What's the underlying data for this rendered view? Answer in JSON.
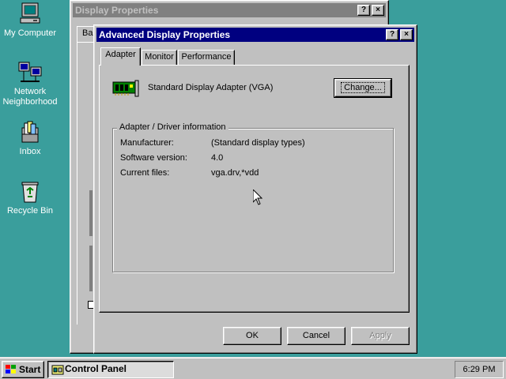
{
  "desktop": {
    "icons": [
      {
        "label": "My Computer"
      },
      {
        "label": "Network Neighborhood"
      },
      {
        "label": "Inbox"
      },
      {
        "label": "Recycle Bin"
      }
    ]
  },
  "back_window": {
    "title": "Display Properties",
    "tab_fragment": "Ba",
    "help_btn": "?",
    "close_btn": "×"
  },
  "dialog": {
    "title": "Advanced Display Properties",
    "help_btn": "?",
    "close_btn": "×",
    "tabs": [
      {
        "label": "Adapter",
        "selected": true
      },
      {
        "label": "Monitor",
        "selected": false
      },
      {
        "label": "Performance",
        "selected": false
      }
    ],
    "adapter_name": "Standard Display Adapter (VGA)",
    "change_button": "Change...",
    "group_title": "Adapter / Driver information",
    "rows": [
      {
        "key": "Manufacturer:",
        "value": "(Standard display types)"
      },
      {
        "key": "Software version:",
        "value": "4.0"
      },
      {
        "key": "Current files:",
        "value": "vga.drv,*vdd"
      }
    ],
    "buttons": {
      "ok": "OK",
      "cancel": "Cancel",
      "apply": "Apply"
    }
  },
  "taskbar": {
    "start_label": "Start",
    "task_label": "Control Panel",
    "clock": "6:29 PM"
  },
  "colors": {
    "desktop": "#3a9e9c",
    "active_title": "#000080",
    "inactive_title": "#808080",
    "face": "#c0c0c0"
  }
}
